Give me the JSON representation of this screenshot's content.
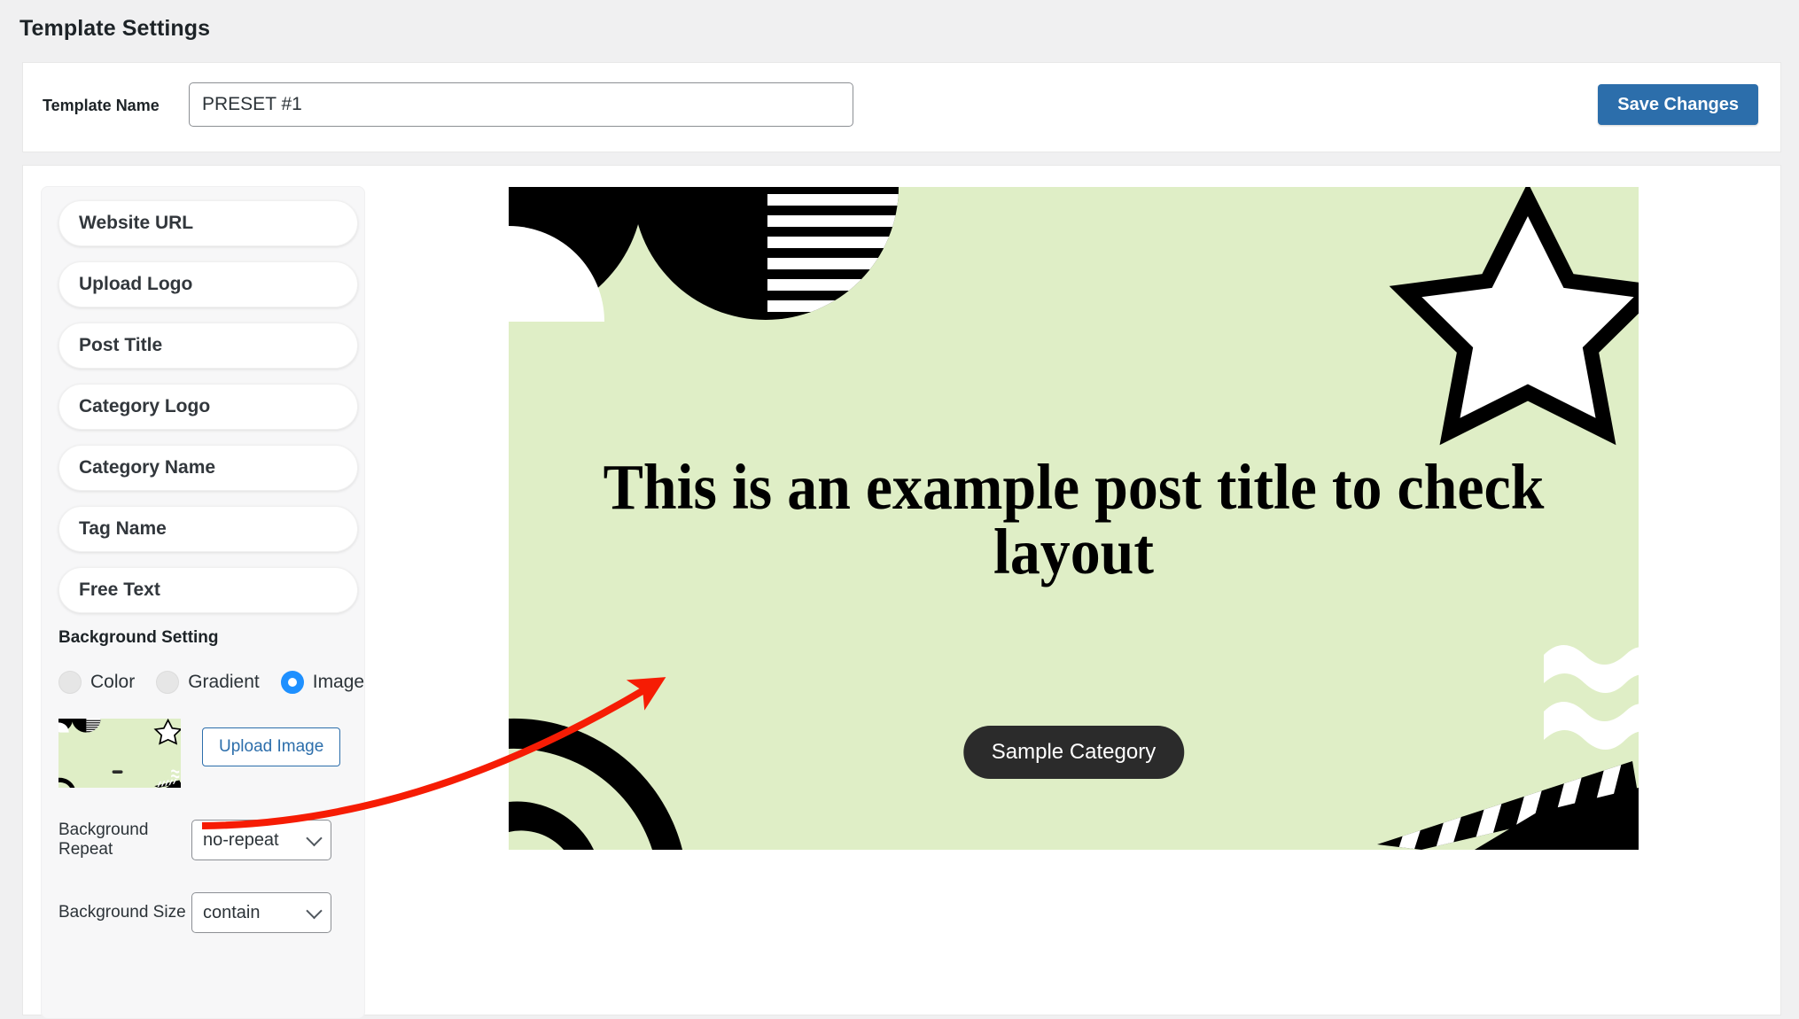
{
  "page": {
    "title": "Template Settings",
    "background_color": "#f0f0f1"
  },
  "header": {
    "template_name_label": "Template Name",
    "template_name_value": "PRESET #1",
    "template_name_placeholder": "Template Name",
    "save_label": "Save Changes",
    "save_color": "#2c6eab"
  },
  "settings": {
    "fields": [
      {
        "label": "Website URL"
      },
      {
        "label": "Upload Logo"
      },
      {
        "label": "Post Title"
      },
      {
        "label": "Category Logo"
      },
      {
        "label": "Category Name"
      },
      {
        "label": "Tag Name"
      },
      {
        "label": "Free Text"
      }
    ],
    "background_setting_title": "Background Setting",
    "background_type_options": [
      {
        "label": "Color",
        "selected": false
      },
      {
        "label": "Gradient",
        "selected": false
      },
      {
        "label": "Image",
        "selected": true
      }
    ],
    "selected_background_type": "Image",
    "accent_color": "#1e90ff",
    "upload_image_label": "Upload Image",
    "background_repeat_label": "Background Repeat",
    "background_repeat_value": "no-repeat",
    "background_size_label": "Background Size",
    "background_size_value": "contain"
  },
  "preview": {
    "background_color": "#dfeec6",
    "post_title": "This is an example post title to check layout",
    "category_label": "Sample Category",
    "category_pill_color": "#2b2b2b",
    "annotation_arrow_color": "#f61c04"
  }
}
